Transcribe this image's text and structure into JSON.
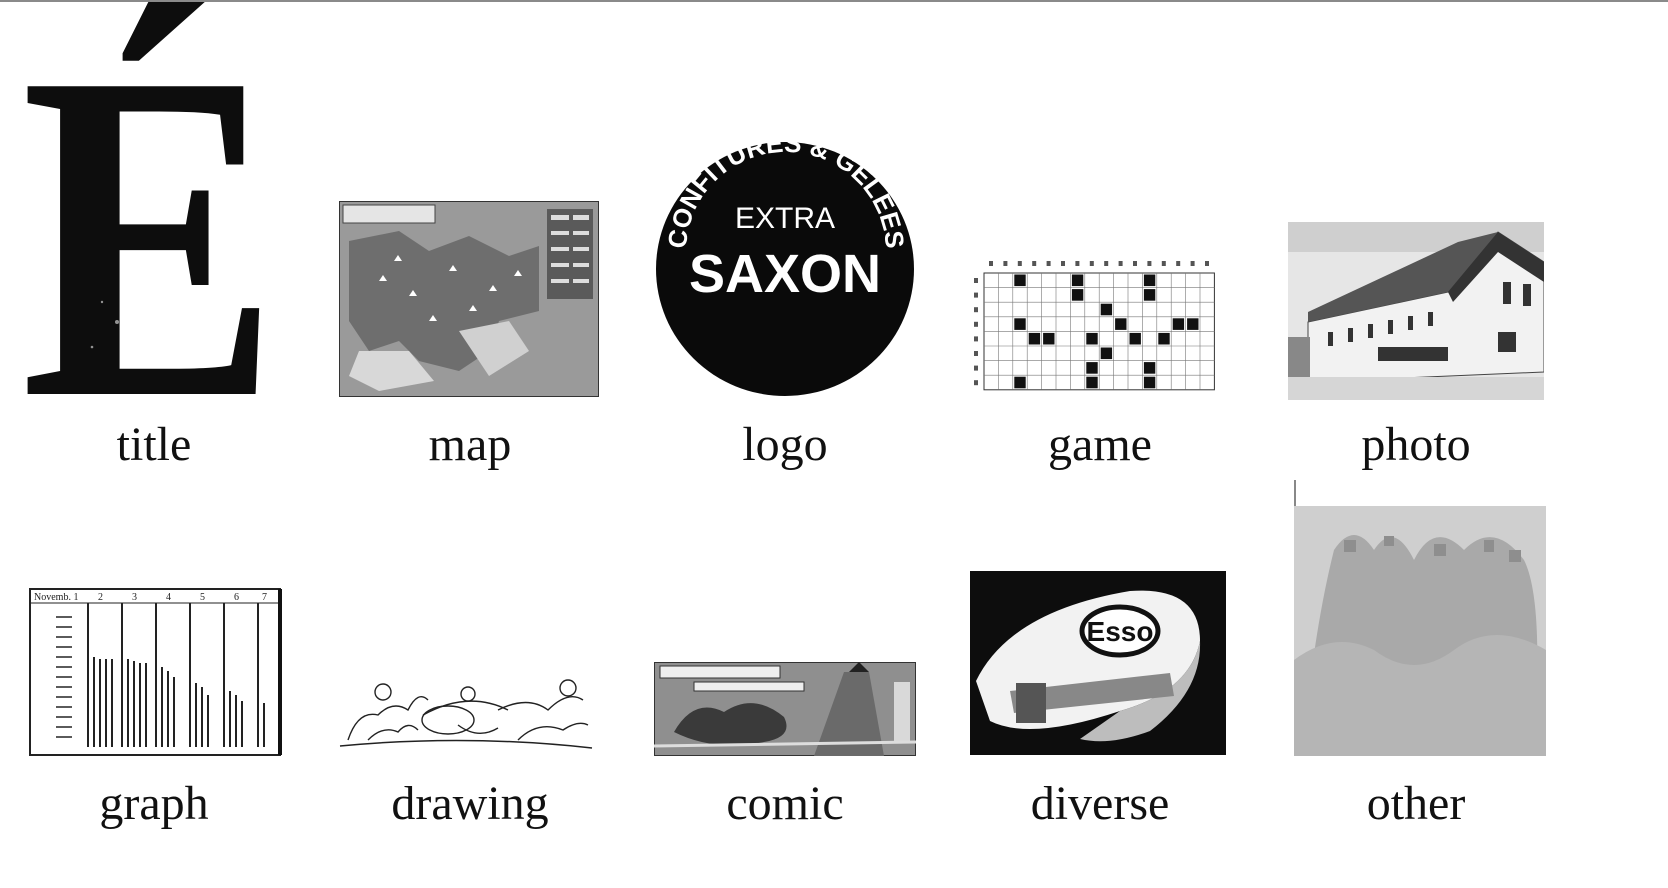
{
  "figure": {
    "categories": [
      {
        "label": "title"
      },
      {
        "label": "map"
      },
      {
        "label": "logo"
      },
      {
        "label": "game"
      },
      {
        "label": "photo"
      },
      {
        "label": "graph"
      },
      {
        "label": "drawing"
      },
      {
        "label": "comic"
      },
      {
        "label": "diverse"
      },
      {
        "label": "other"
      }
    ],
    "samples": {
      "title_letter": "É",
      "logo_arc_text": "CONFITURES & GELÉES",
      "logo_line1": "EXTRA",
      "logo_line2": "SAXON",
      "diverse_brand": "Esso",
      "graph_header": [
        "Novemb. 1",
        "2",
        "3",
        "4",
        "5",
        "6",
        "7"
      ]
    },
    "colors": {
      "ink": "#111111",
      "paper": "#ffffff",
      "map_gray": "#8c8c8c",
      "other_gray": "#bdbdbd"
    }
  }
}
